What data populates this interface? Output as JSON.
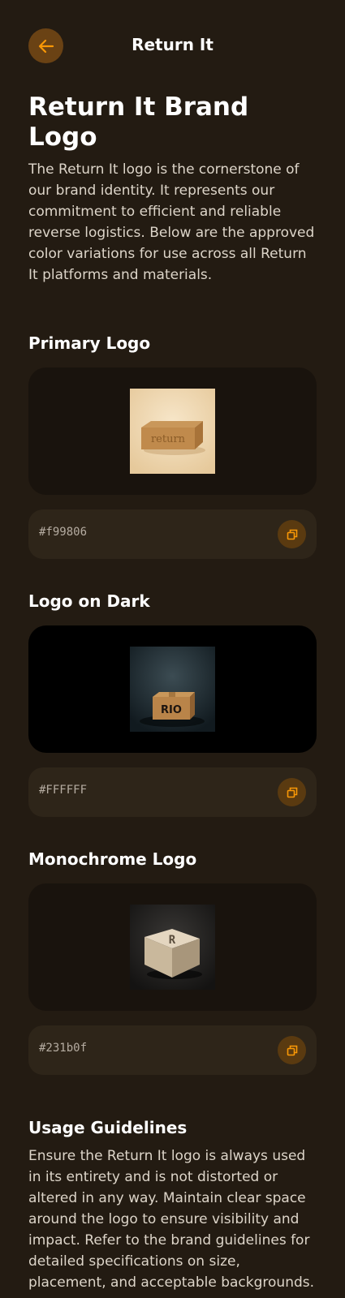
{
  "header": {
    "title": "Return It",
    "back_icon": "arrow-left-icon"
  },
  "intro": {
    "title": "Return It Brand Logo",
    "description": "The Return It logo is the cornerstone of our brand identity. It represents our commitment to efficient and reliable reverse logistics. Below are the approved color variations for use across all Return It platforms and materials."
  },
  "variants": [
    {
      "title": "Primary Logo",
      "hex": "#f99806",
      "image_text": "return"
    },
    {
      "title": "Logo on Dark",
      "hex": "#FFFFFF",
      "image_text": "RIO"
    },
    {
      "title": "Monochrome Logo",
      "hex": "#231b0f",
      "image_text": "R"
    }
  ],
  "guidelines": {
    "title": "Usage Guidelines",
    "text": "Ensure the Return It logo is always used in its entirety and is not distorted or altered in any way. Maintain clear space around the logo to ensure visibility and impact. Refer to the brand guidelines for detailed specifications on size, placement, and acceptable backgrounds."
  },
  "colors": {
    "background": "#231b12",
    "accent": "#f99806",
    "card": "#19130d",
    "row": "#2e2519"
  },
  "icons": {
    "copy": "copy-icon"
  }
}
